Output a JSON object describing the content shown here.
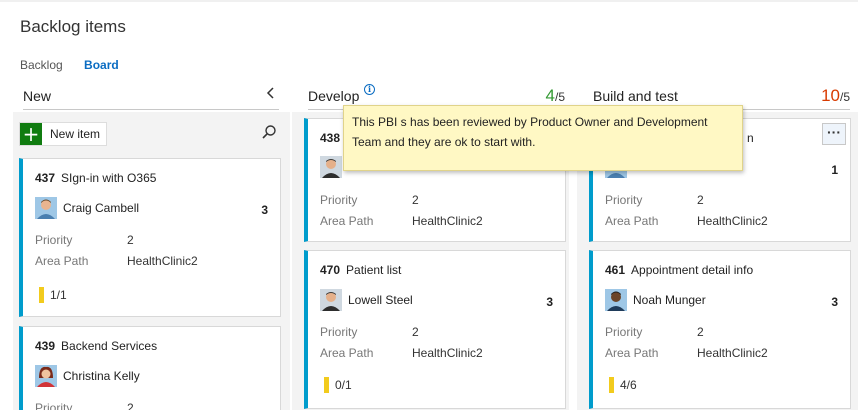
{
  "page": {
    "title": "Backlog items"
  },
  "pivots": [
    {
      "label": "Backlog",
      "active": false
    },
    {
      "label": "Board",
      "active": true
    }
  ],
  "columns": {
    "new": {
      "name": "New",
      "collapse_icon": "chevron-left-icon"
    },
    "develop": {
      "name": "Develop",
      "count": "4",
      "limit": "/5",
      "info_icon": "info-icon"
    },
    "build": {
      "name": "Build and test",
      "count": "10",
      "limit": "/5"
    }
  },
  "toolbar": {
    "new_item_label": "New item",
    "plus_icon": "+",
    "search_icon": "search-icon"
  },
  "tooltip": {
    "text": "This PBI s has been reviewed by Product Owner and Development Team and they are ok to start with."
  },
  "field_labels": {
    "priority": "Priority",
    "area_path": "Area Path"
  },
  "cards": {
    "new": [
      {
        "id": "437",
        "title": "SIgn-in with O365",
        "assignee": "Craig Cambell",
        "effort": "3",
        "priority": "2",
        "area_path": "HealthClinic2",
        "tasks": "1/1"
      },
      {
        "id": "439",
        "title": "Backend Services",
        "assignee": "Christina Kelly",
        "priority": "2"
      }
    ],
    "develop": [
      {
        "id": "438",
        "priority": "2",
        "area_path": "HealthClinic2"
      },
      {
        "id": "470",
        "title": "Patient list",
        "assignee": "Lowell Steel",
        "effort": "3",
        "priority": "2",
        "area_path": "HealthClinic2",
        "tasks": "0/1"
      }
    ],
    "build": [
      {
        "title_tail": "n",
        "effort": "1",
        "priority": "2",
        "area_path": "HealthClinic2",
        "more_label": "···"
      },
      {
        "id": "461",
        "title": "Appointment detail info",
        "assignee": "Noah Munger",
        "effort": "3",
        "priority": "2",
        "area_path": "HealthClinic2",
        "tasks": "4/6"
      }
    ]
  },
  "colors": {
    "accent": "#0a6cc2",
    "card_stripe": "#009ccc",
    "wip_ok": "#339933",
    "wip_over": "#d83b01",
    "task_bar": "#f2cb1d",
    "tooltip_bg": "#fff8c4",
    "new_button": "#107c10"
  }
}
